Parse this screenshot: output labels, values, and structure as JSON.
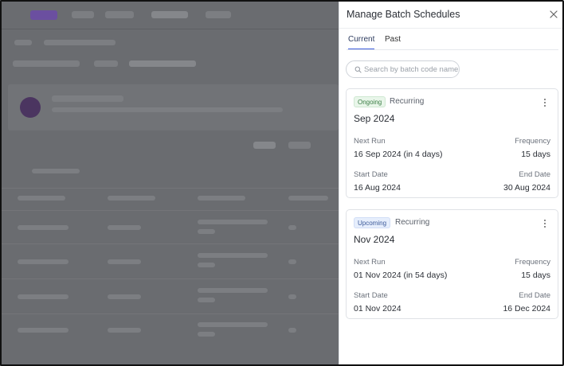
{
  "drawer": {
    "title": "Manage Batch Schedules",
    "tabs": [
      {
        "label": "Current",
        "active": true
      },
      {
        "label": "Past",
        "active": false
      }
    ],
    "search": {
      "placeholder": "Search by batch code name",
      "value": ""
    },
    "cards": [
      {
        "status": "Ongoing",
        "type": "Recurring",
        "title": "Sep 2024",
        "next_run_label": "Next Run",
        "next_run": "16 Sep 2024 (in 4 days)",
        "frequency_label": "Frequency",
        "frequency": "15 days",
        "start_label": "Start Date",
        "start": "16 Aug 2024",
        "end_label": "End Date",
        "end": "30 Aug 2024"
      },
      {
        "status": "Upcoming",
        "type": "Recurring",
        "title": "Nov 2024",
        "next_run_label": "Next Run",
        "next_run": "01 Nov 2024 (in 54 days)",
        "frequency_label": "Frequency",
        "frequency": "15 days",
        "start_label": "Start Date",
        "start": "01 Nov 2024",
        "end_label": "End Date",
        "end": "16 Dec 2024"
      }
    ]
  },
  "icons": {
    "close": "close-icon",
    "search": "search-icon",
    "menu": "kebab-menu-icon"
  },
  "colors": {
    "accent": "#3b5bdb",
    "ongoing": "#3a7d44",
    "upcoming": "#3d5a99",
    "overlay": "#6a6c70"
  }
}
